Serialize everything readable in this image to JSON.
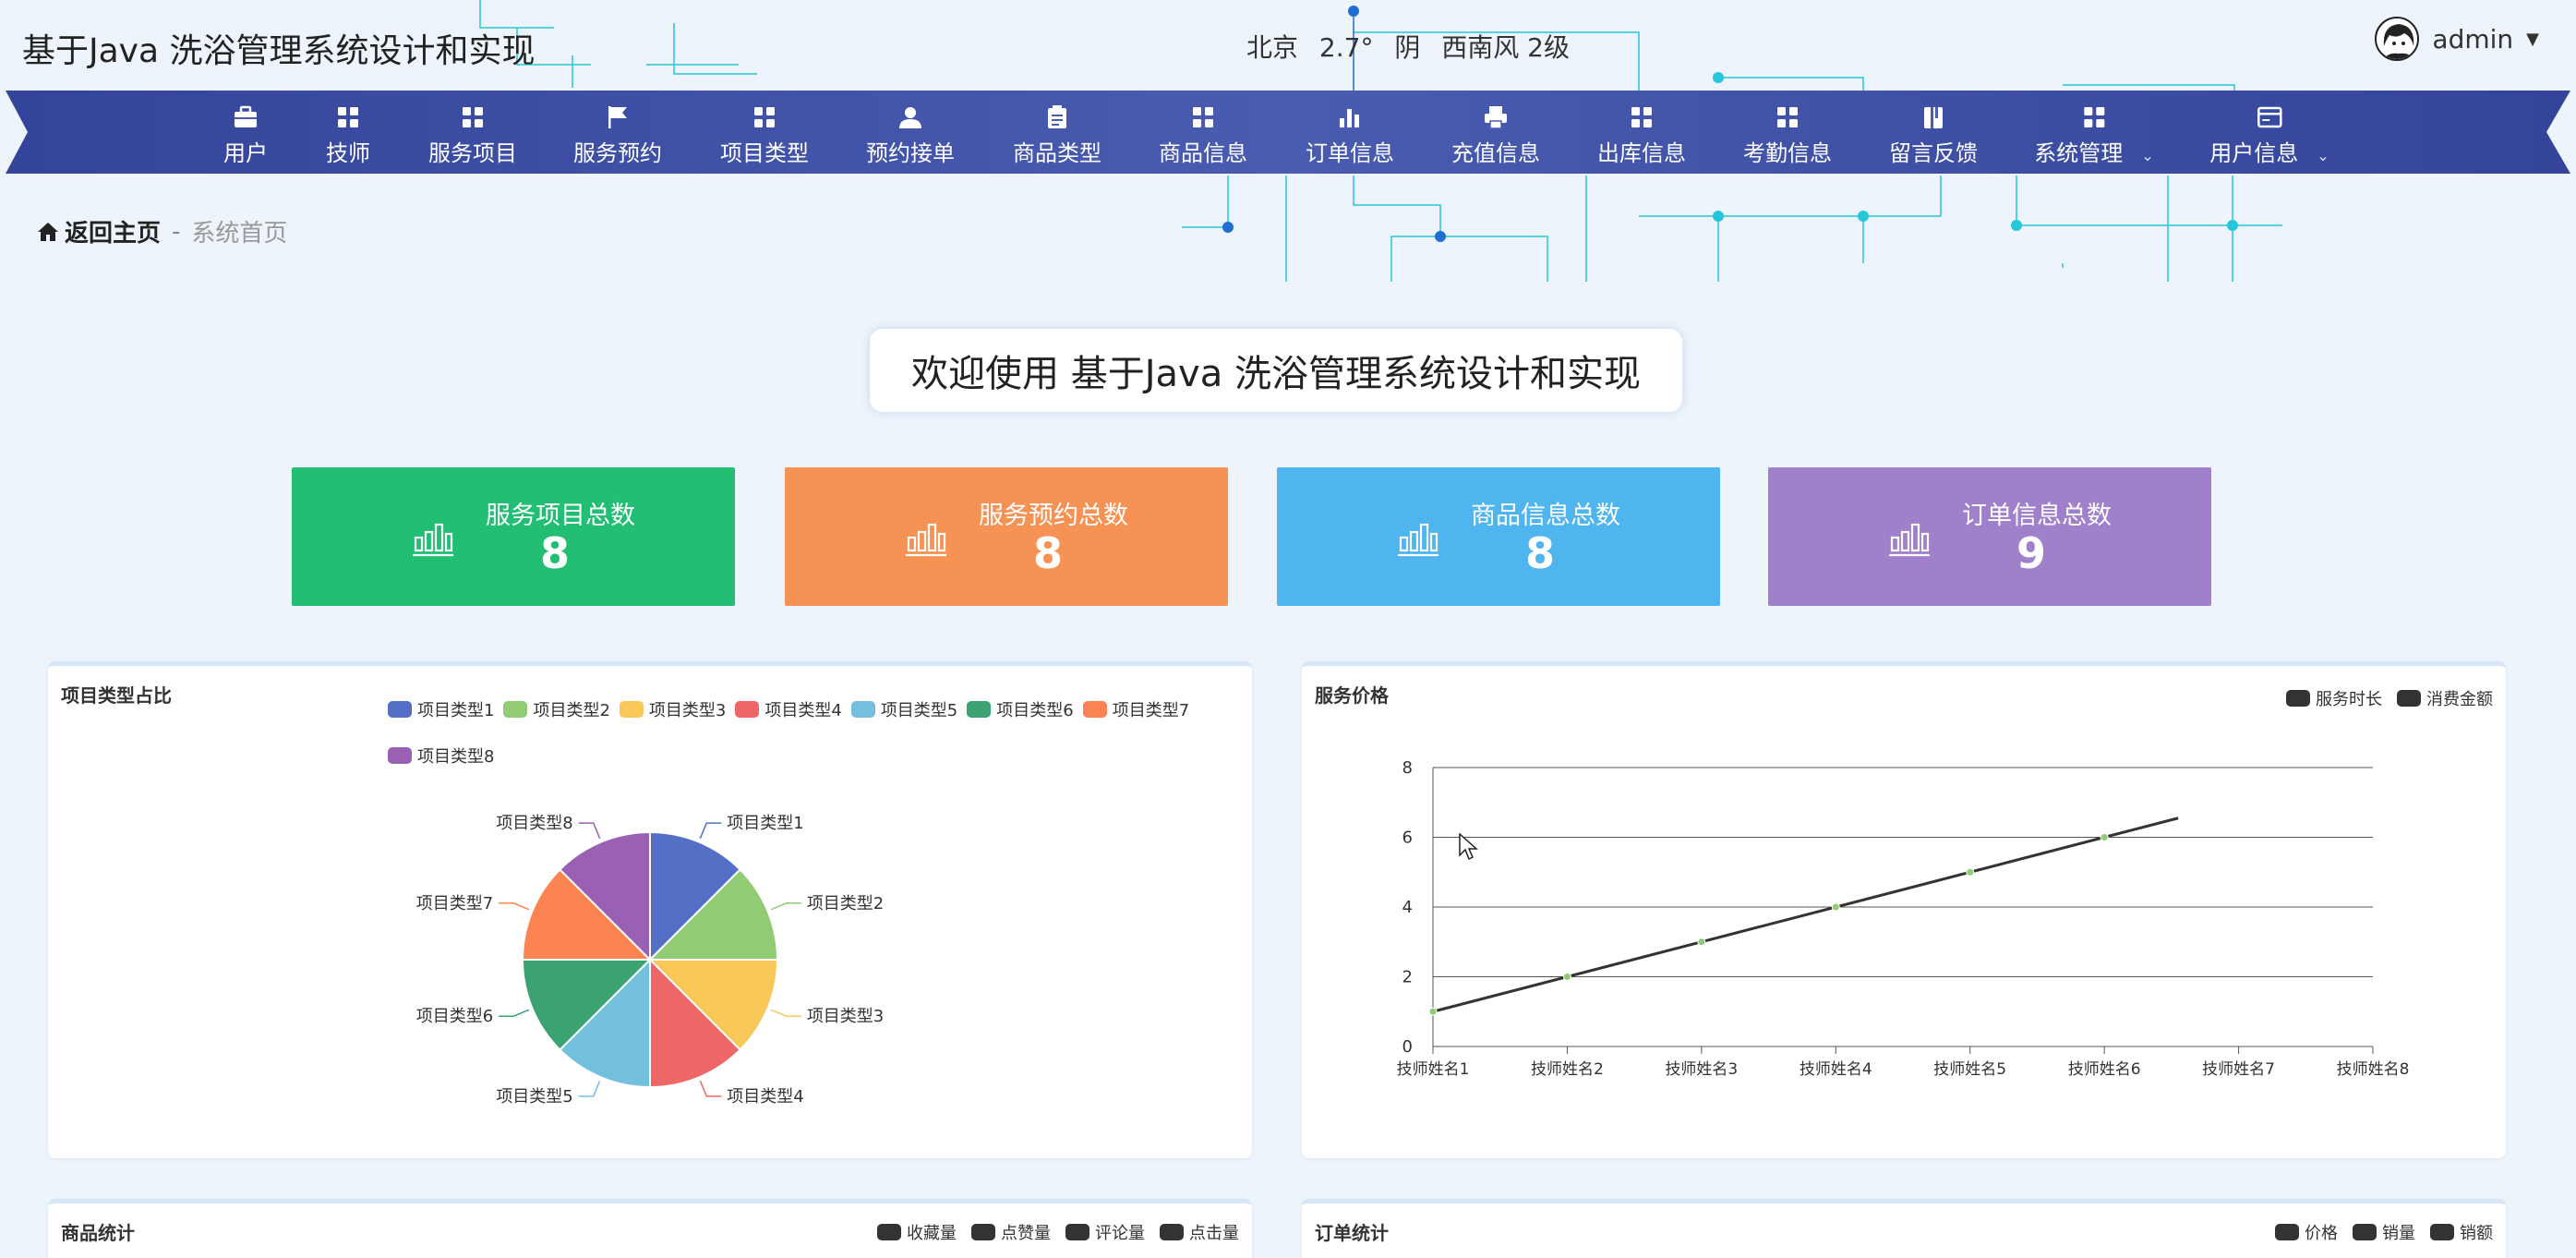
{
  "header": {
    "title": "基于Java 洗浴管理系统设计和实现",
    "weather": {
      "city": "北京",
      "temp": "2.7°",
      "condition": "阴",
      "wind": "西南风 2级"
    },
    "user": {
      "name": "admin",
      "menu_caret": "▼"
    }
  },
  "nav": {
    "items": [
      {
        "label": "用户",
        "icon": "briefcase-icon"
      },
      {
        "label": "技师",
        "icon": "grid-icon"
      },
      {
        "label": "服务项目",
        "icon": "grid-icon"
      },
      {
        "label": "服务预约",
        "icon": "flag-icon"
      },
      {
        "label": "项目类型",
        "icon": "grid-icon"
      },
      {
        "label": "预约接单",
        "icon": "person-icon"
      },
      {
        "label": "商品类型",
        "icon": "clipboard-icon"
      },
      {
        "label": "商品信息",
        "icon": "grid-icon"
      },
      {
        "label": "订单信息",
        "icon": "bar-chart-icon"
      },
      {
        "label": "充值信息",
        "icon": "printer-icon"
      },
      {
        "label": "出库信息",
        "icon": "grid-icon"
      },
      {
        "label": "考勤信息",
        "icon": "grid-icon"
      },
      {
        "label": "留言反馈",
        "icon": "book-icon"
      },
      {
        "label": "系统管理",
        "icon": "grid-icon",
        "dropdown": "⌄"
      },
      {
        "label": "用户信息",
        "icon": "card-icon",
        "dropdown": "⌄"
      }
    ]
  },
  "breadcrumb": {
    "home": "返回主页",
    "sep": "-",
    "current": "系统首页"
  },
  "welcome": "欢迎使用 基于Java 洗浴管理系统设计和实现",
  "stats": [
    {
      "label": "服务项目总数",
      "value": "8",
      "color": "#21be74"
    },
    {
      "label": "服务预约总数",
      "value": "8",
      "color": "#f79255"
    },
    {
      "label": "商品信息总数",
      "value": "8",
      "color": "#4fb5ee"
    },
    {
      "label": "订单信息总数",
      "value": "9",
      "color": "#a07fcb"
    }
  ],
  "colors": {
    "nav": "#3d4fa0",
    "bg": "#edf4fb"
  },
  "panels": {
    "pie": {
      "title": "项目类型占比"
    },
    "line": {
      "title": "服务价格",
      "legend": [
        "服务时长",
        "消费金额"
      ]
    },
    "goods": {
      "title": "商品统计",
      "legend": [
        "收藏量",
        "点赞量",
        "评论量",
        "点击量"
      ]
    },
    "orders": {
      "title": "订单统计",
      "legend": [
        "价格",
        "销量",
        "销额"
      ]
    }
  },
  "chart_data": [
    {
      "type": "pie",
      "title": "项目类型占比",
      "categories": [
        "项目类型1",
        "项目类型2",
        "项目类型3",
        "项目类型4",
        "项目类型5",
        "项目类型6",
        "项目类型7",
        "项目类型8"
      ],
      "values": [
        1,
        1,
        1,
        1,
        1,
        1,
        1,
        1
      ],
      "colors": [
        "#5470c6",
        "#91cc75",
        "#fac858",
        "#ee6666",
        "#73c0de",
        "#3ba272",
        "#fc8452",
        "#9a60b4"
      ],
      "legend_position": "top-right"
    },
    {
      "type": "line",
      "title": "服务价格",
      "categories": [
        "技师姓名1",
        "技师姓名2",
        "技师姓名3",
        "技师姓名4",
        "技师姓名5",
        "技师姓名6",
        "技师姓名7",
        "技师姓名8"
      ],
      "series": [
        {
          "name": "消费金额",
          "values": [
            1,
            2,
            3,
            4,
            5,
            6,
            null,
            null
          ]
        }
      ],
      "trend": {
        "from": [
          0,
          1
        ],
        "to": [
          5.55,
          6.55
        ]
      },
      "yticks": [
        0,
        2,
        4,
        6,
        8
      ],
      "ylim": [
        0,
        8
      ],
      "grid": true,
      "legend_position": "top-right"
    }
  ]
}
